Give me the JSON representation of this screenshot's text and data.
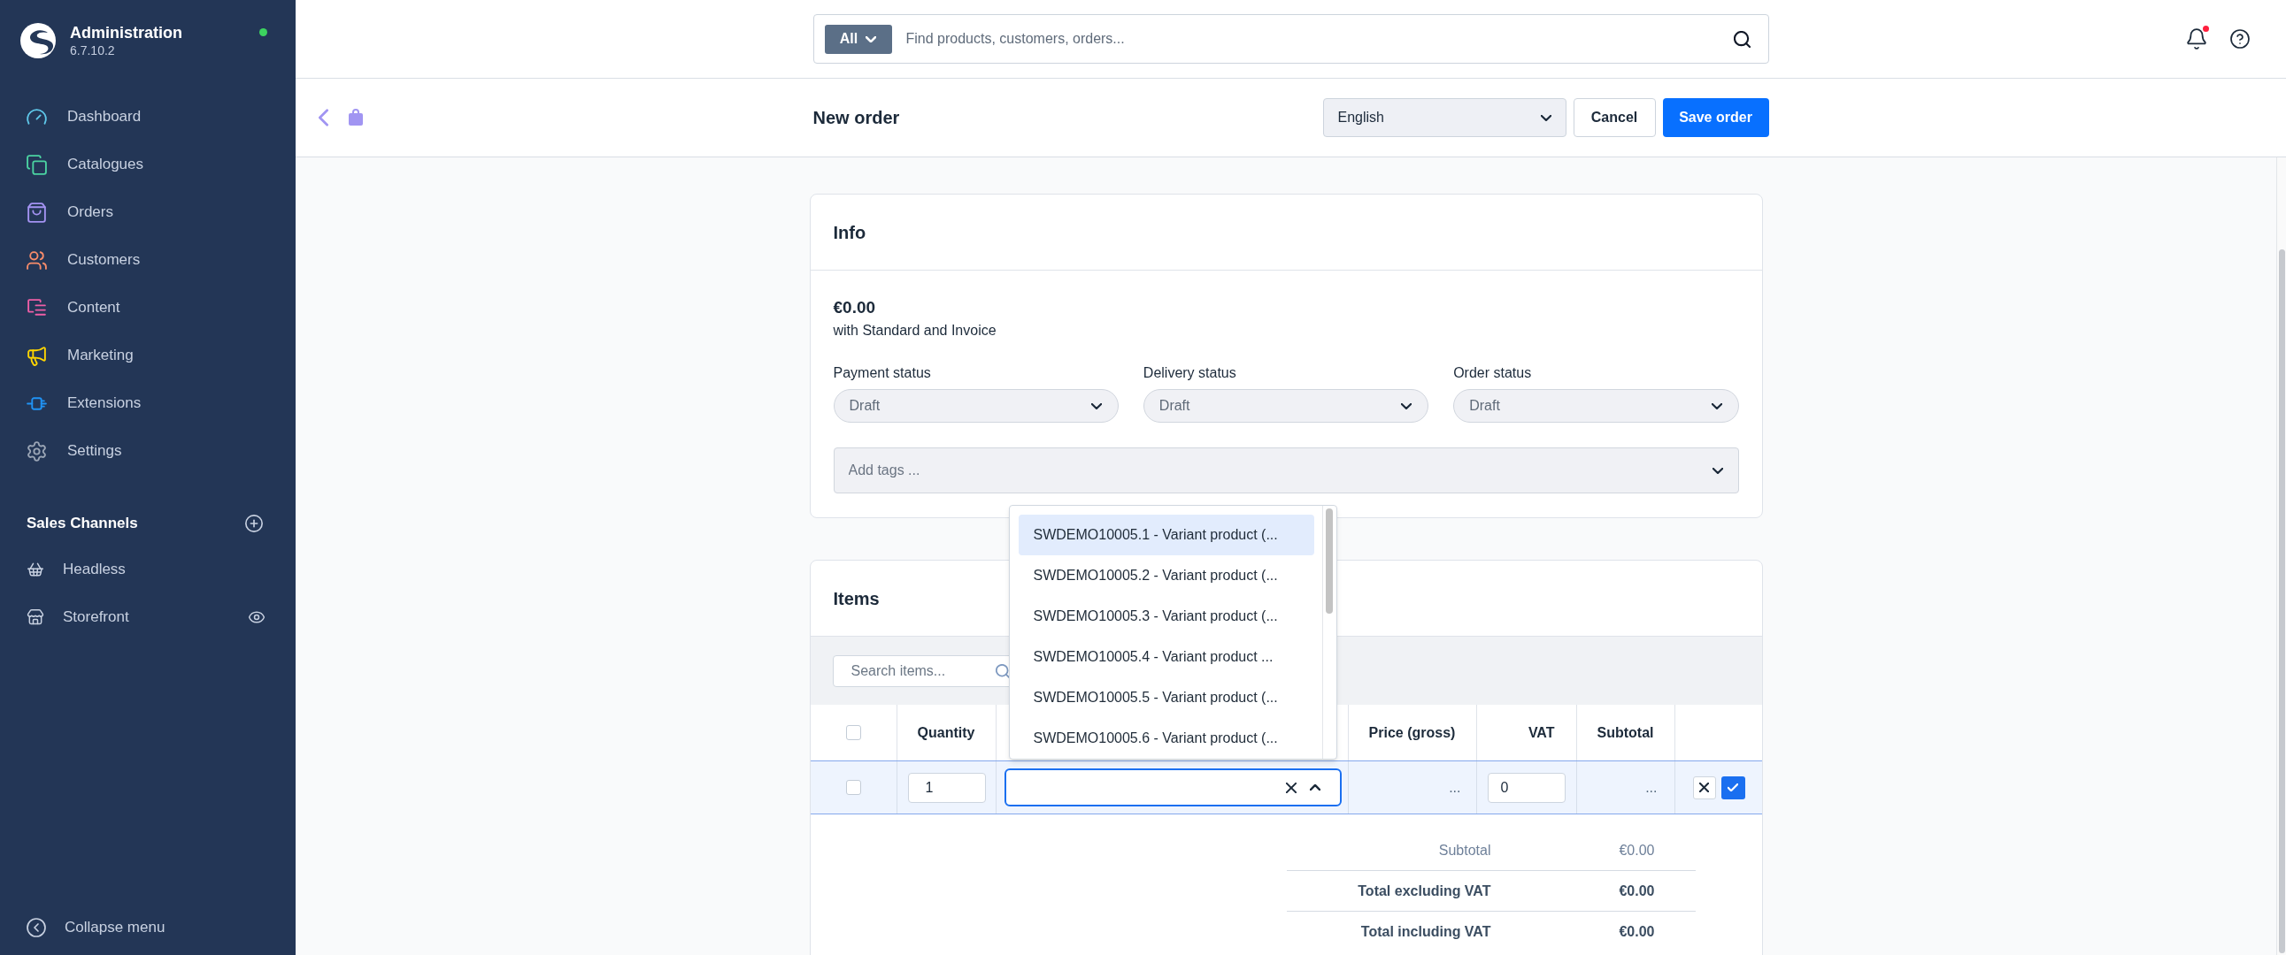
{
  "sidebar": {
    "brand": {
      "title": "Administration",
      "version": "6.7.10.2",
      "online": true
    },
    "nav": [
      {
        "label": "Dashboard",
        "color": "#5fc8ea"
      },
      {
        "label": "Catalogues",
        "color": "#4bd3a2"
      },
      {
        "label": "Orders",
        "color": "#a493f2"
      },
      {
        "label": "Customers",
        "color": "#f98c6a"
      },
      {
        "label": "Content",
        "color": "#ef5fa7"
      },
      {
        "label": "Marketing",
        "color": "#ffd600"
      },
      {
        "label": "Extensions",
        "color": "#2093f5"
      },
      {
        "label": "Settings",
        "color": "#9aa5b5"
      }
    ],
    "sales_channels": {
      "title": "Sales Channels",
      "items": [
        {
          "label": "Headless",
          "kind": "headless"
        },
        {
          "label": "Storefront",
          "kind": "storefront"
        }
      ]
    },
    "collapse": {
      "label": "Collapse menu"
    }
  },
  "header": {
    "search": {
      "scope": "All",
      "placeholder": "Find products, customers, orders..."
    },
    "notifications": {
      "unread": true
    }
  },
  "smart_bar": {
    "title": "New order",
    "language": "English",
    "buttons": [
      {
        "label": "Cancel",
        "kind": "secondary"
      },
      {
        "label": "Save order",
        "kind": "primary"
      }
    ]
  },
  "info": {
    "title": "Info",
    "total": "€0.00",
    "summary": "with Standard and Invoice",
    "statuses": [
      {
        "label": "Payment status",
        "value": "Draft",
        "disabled": true
      },
      {
        "label": "Delivery status",
        "value": "Draft",
        "disabled": true
      },
      {
        "label": "Order status",
        "value": "Draft",
        "disabled": true
      }
    ],
    "tags": {
      "placeholder": "Add tags ...",
      "disabled": true
    }
  },
  "items": {
    "title": "Items",
    "search": {
      "placeholder": "Search items..."
    },
    "columns": [
      {
        "kind": "checkbox",
        "checked": false
      },
      {
        "kind": "text",
        "label": "Quantity"
      },
      {
        "kind": "blank"
      },
      {
        "kind": "text",
        "label": "Price (gross)"
      },
      {
        "kind": "text",
        "label": "VAT"
      },
      {
        "kind": "text",
        "label": "Subtotal"
      },
      {
        "kind": "blank"
      }
    ],
    "rows": [
      {
        "checked": false,
        "editing": true,
        "quantity": "1",
        "product": {
          "expanded": true,
          "options": [
            {
              "label": "SWDEMO10005.1 - Variant product (...",
              "selected": true
            },
            {
              "label": "SWDEMO10005.2 - Variant product (...",
              "selected": false
            },
            {
              "label": "SWDEMO10005.3 - Variant product (...",
              "selected": false
            },
            {
              "label": "SWDEMO10005.4 - Variant product ...",
              "selected": false
            },
            {
              "label": "SWDEMO10005.5 - Variant product (...",
              "selected": false
            },
            {
              "label": "SWDEMO10005.6 - Variant product (...",
              "selected": false
            }
          ]
        },
        "price": "...",
        "vat": "0",
        "subtotal": "..."
      }
    ],
    "summary": [
      {
        "kind": "subtotal",
        "label": "Subtotal",
        "value": "€0.00"
      },
      {
        "kind": "total",
        "label": "Total excluding VAT",
        "value": "€0.00"
      },
      {
        "kind": "total",
        "label": "Total including VAT",
        "value": "€0.00"
      }
    ]
  }
}
